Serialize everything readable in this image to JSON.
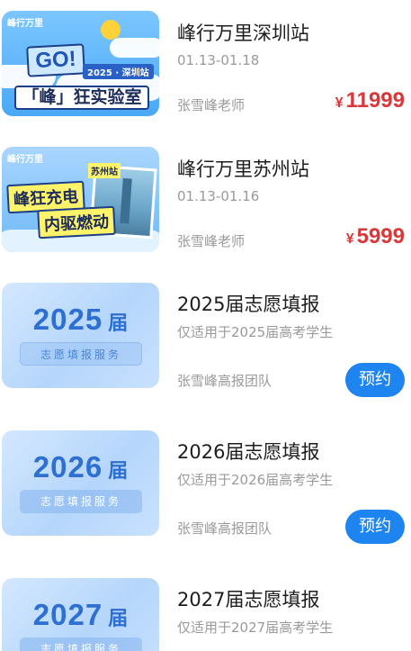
{
  "items": [
    {
      "type": "trip",
      "title": "峰行万里深圳站",
      "dates": "01.13-01.18",
      "teacher": "张雪峰老师",
      "currency": "¥",
      "price": "11999",
      "thumb": {
        "logo": "峰行万里",
        "go": "GO!",
        "tag": "2025 · 深圳站",
        "banner": "「峰」狂实验室"
      }
    },
    {
      "type": "trip",
      "title": "峰行万里苏州站",
      "dates": "01.13-01.16",
      "teacher": "张雪峰老师",
      "currency": "¥",
      "price": "5999",
      "thumb": {
        "logo": "峰行万里",
        "city": "苏州站",
        "line1": "峰狂充电",
        "line2": "内驱燃动"
      }
    },
    {
      "type": "volunteer",
      "title": "2025届志愿填报",
      "desc": "仅适用于2025届高考学生",
      "team": "张雪峰高报团队",
      "button": "预约",
      "thumb": {
        "year": "2025",
        "suffix": "届",
        "pill": "志愿填报服务"
      }
    },
    {
      "type": "volunteer",
      "title": "2026届志愿填报",
      "desc": "仅适用于2026届高考学生",
      "team": "张雪峰高报团队",
      "button": "预约",
      "thumb": {
        "year": "2026",
        "suffix": "届",
        "pill": "志愿填报服务"
      }
    },
    {
      "type": "volunteer",
      "title": "2027届志愿填报",
      "desc": "仅适用于2027届高考学生",
      "thumb": {
        "year": "2027",
        "suffix": "届",
        "pill": "志愿填报服务"
      }
    }
  ]
}
